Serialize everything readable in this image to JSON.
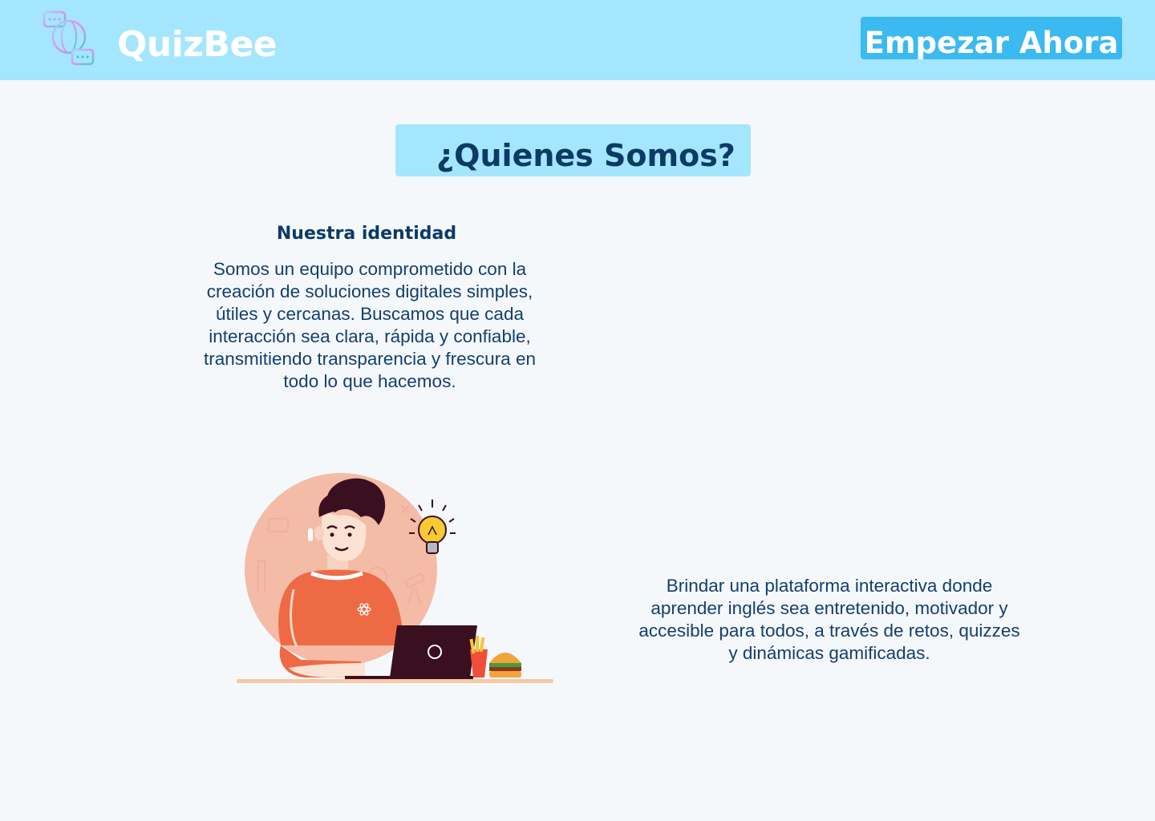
{
  "header": {
    "brand": "QuizBee",
    "cta_label": "Empezar Ahora",
    "background": "#a4e6fd",
    "cta_color": "#3bb9f1"
  },
  "main": {
    "title": "¿Quienes Somos?",
    "identity": {
      "heading": "Nuestra identidad",
      "text": "Somos un equipo comprometido con la creación de soluciones digitales simples, útiles y cercanas. Buscamos que cada interacción sea clara, rápida y confiable, transmitiendo transparencia y frescura en todo lo que hacemos."
    },
    "mission": {
      "text": "Brindar una plataforma interactiva donde aprender inglés sea entretenido, motivador y accesible para todos, a través de retos, quizzes y dinámicas gamificadas."
    },
    "illustration": {
      "icon": "student-laptop-illustration"
    }
  },
  "colors": {
    "page_background": "#f5f8fb",
    "text_dark": "#0b3a66",
    "accent_orange": "#ee6a45"
  }
}
